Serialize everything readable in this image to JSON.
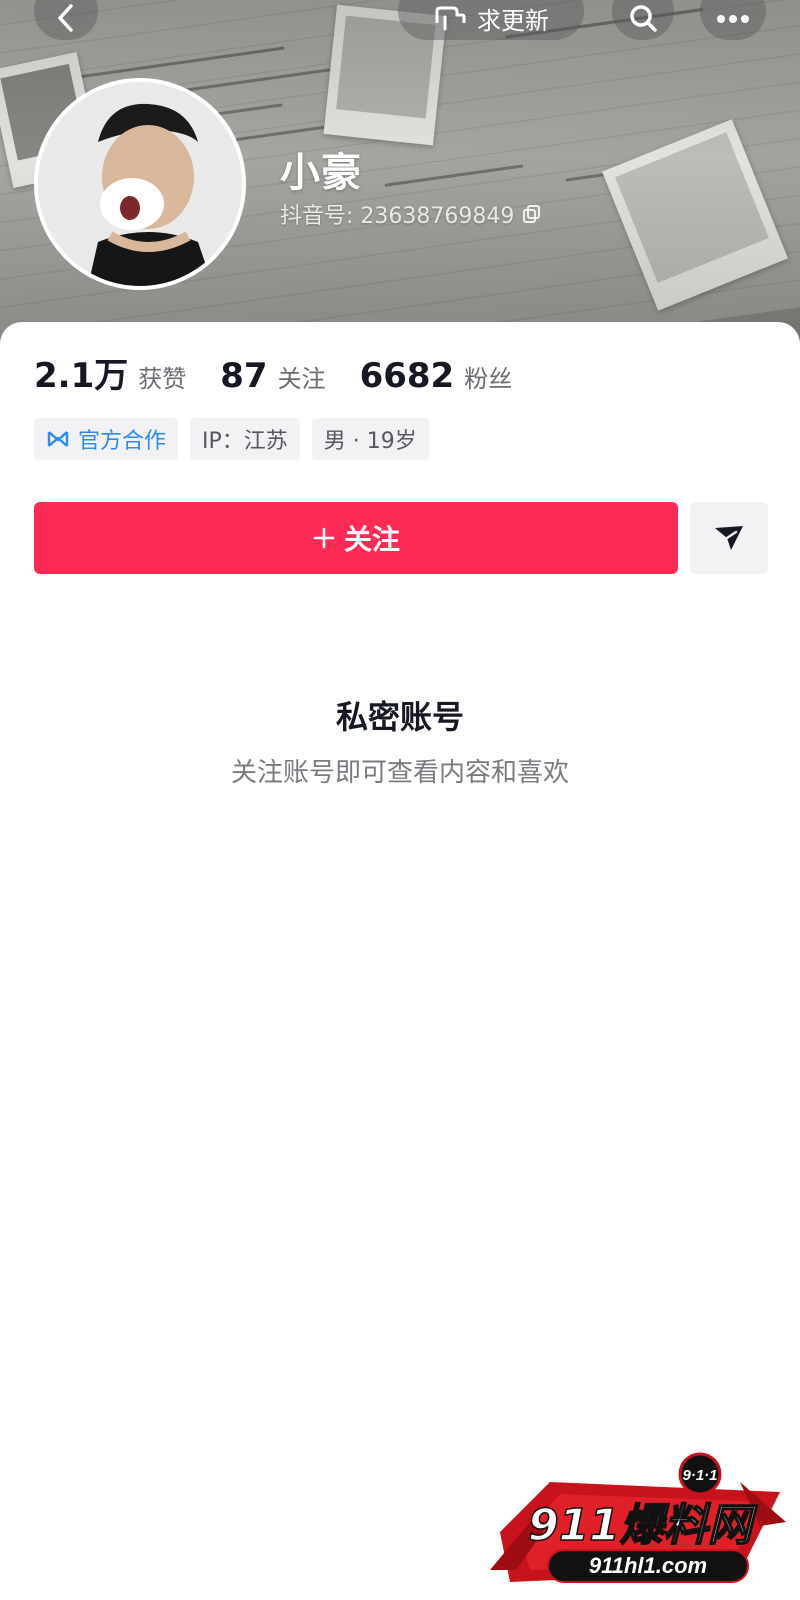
{
  "header": {
    "update_label": "求更新",
    "icons": [
      "back-chevron-icon",
      "hand-request-icon",
      "search-icon",
      "more-dots-icon"
    ]
  },
  "profile": {
    "nickname": "小豪",
    "douyin_id_label": "抖音号: 23638769849",
    "copy_icon": "copy-icon"
  },
  "stats": [
    {
      "value": "2.1万",
      "label": "获赞"
    },
    {
      "value": "87",
      "label": "关注"
    },
    {
      "value": "6682",
      "label": "粉丝"
    }
  ],
  "tags": {
    "official": "官方合作",
    "ip": "IP：江苏",
    "gender_age": "男 · 19岁"
  },
  "actions": {
    "follow_label": "关注",
    "follow_color": "#fe2c55"
  },
  "private": {
    "title": "私密账号",
    "subtitle": "关注账号即可查看内容和喜欢"
  },
  "watermark": {
    "badge": "9·1·1",
    "brand": "911爆料网",
    "site": "911hl1.com"
  }
}
